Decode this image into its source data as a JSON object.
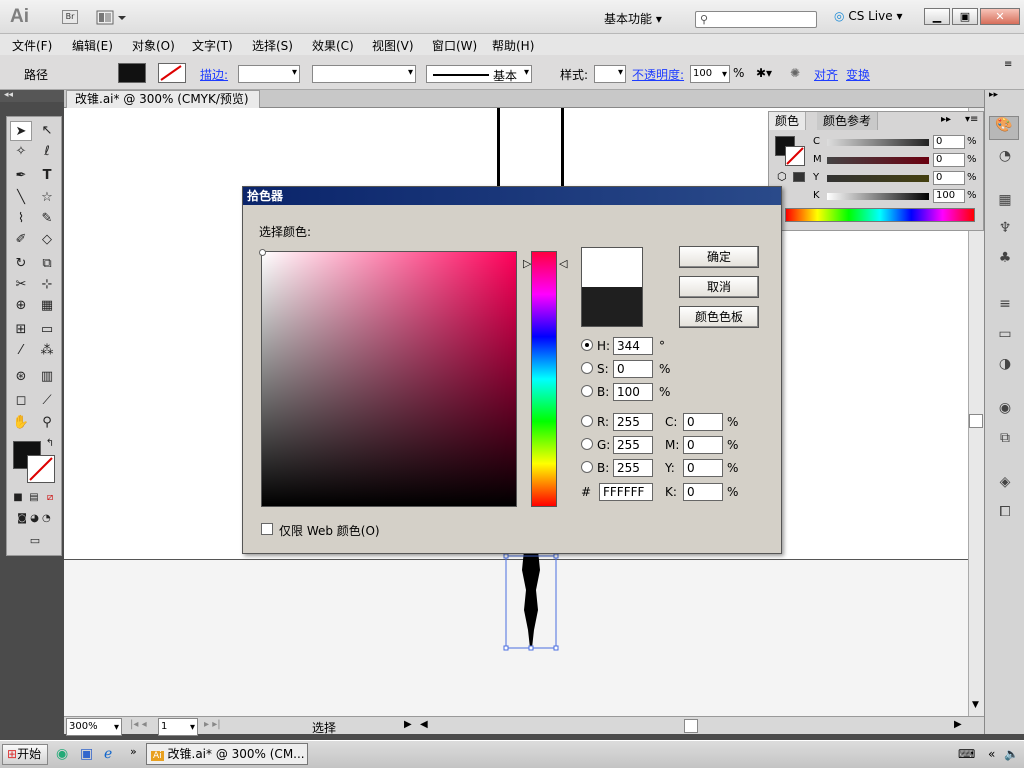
{
  "app": {
    "logo": "Ai",
    "bridge_badge": "Br",
    "workspace": "基本功能",
    "search_placeholder": "",
    "cslive": "CS Live"
  },
  "menu": [
    "文件(F)",
    "编辑(E)",
    "对象(O)",
    "文字(T)",
    "选择(S)",
    "效果(C)",
    "视图(V)",
    "窗口(W)",
    "帮助(H)"
  ],
  "control": {
    "mode": "路径",
    "stroke_label": "描边:",
    "stroke_style": "基本",
    "style_label": "样式:",
    "opacity_label": "不透明度:",
    "opacity_value": "100",
    "opacity_unit": "%",
    "align_link": "对齐",
    "transform_link": "变换"
  },
  "document": {
    "tab_title": "改锥.ai* @ 300% (CMYK/预览)",
    "zoom": "300%",
    "page": "1",
    "status": "选择"
  },
  "color_panel": {
    "tab_color": "颜色",
    "tab_guide": "颜色参考",
    "channels": [
      {
        "label": "C",
        "value": "0",
        "unit": "%"
      },
      {
        "label": "M",
        "value": "0",
        "unit": "%"
      },
      {
        "label": "Y",
        "value": "0",
        "unit": "%"
      },
      {
        "label": "K",
        "value": "100",
        "unit": "%"
      }
    ]
  },
  "picker": {
    "title": "拾色器",
    "prompt": "选择颜色:",
    "buttons": {
      "ok": "确定",
      "cancel": "取消",
      "swatches": "颜色色板"
    },
    "hsb": [
      {
        "label": "H:",
        "value": "344",
        "unit": "°",
        "checked": true
      },
      {
        "label": "S:",
        "value": "0",
        "unit": "%",
        "checked": false
      },
      {
        "label": "B:",
        "value": "100",
        "unit": "%",
        "checked": false
      }
    ],
    "rgb": [
      {
        "label": "R:",
        "value": "255"
      },
      {
        "label": "G:",
        "value": "255"
      },
      {
        "label": "B:",
        "value": "255"
      }
    ],
    "cmyk": [
      {
        "label": "C:",
        "value": "0",
        "unit": "%"
      },
      {
        "label": "M:",
        "value": "0",
        "unit": "%"
      },
      {
        "label": "Y:",
        "value": "0",
        "unit": "%"
      },
      {
        "label": "K:",
        "value": "0",
        "unit": "%"
      }
    ],
    "hex_label": "#",
    "hex_value": "FFFFFF",
    "web_only": "仅限 Web 颜色(O)",
    "new_color": "#ffffff",
    "old_color": "#1f1f1f"
  },
  "taskbar": {
    "start": "开始",
    "item": "改锥.ai* @ 300% (CM..."
  }
}
